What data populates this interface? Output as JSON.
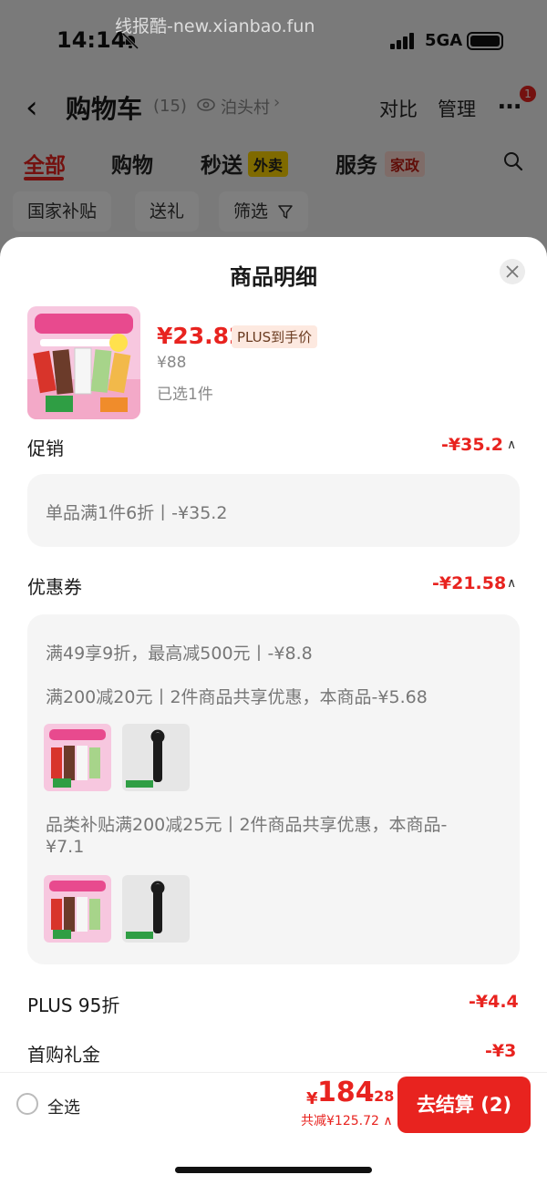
{
  "watermark": "线报酷-new.xianbao.fun",
  "status_bar": {
    "time": "14:14",
    "network": "5GA",
    "icons": [
      "bell-off-icon",
      "signal-icon",
      "battery-icon"
    ]
  },
  "navbar": {
    "title": "购物车",
    "count": "(15)",
    "location": "泊头村",
    "actions": [
      "对比",
      "管理"
    ],
    "more_badge": "1"
  },
  "category_tabs": [
    {
      "label": "全部",
      "active": true
    },
    {
      "label": "购物"
    },
    {
      "label": "秒送",
      "tag": "外卖"
    },
    {
      "label": "服务",
      "tag": "家政"
    }
  ],
  "filters": [
    "国家补贴",
    "送礼",
    "筛选"
  ],
  "sheet": {
    "title": "商品明细",
    "product": {
      "price": "¥23.82",
      "price_tag": "PLUS到手价",
      "original_price": "¥88",
      "selected": "已选1件"
    },
    "promotion": {
      "label": "促销",
      "amount": "-¥35.2",
      "details": [
        "单品满1件6折丨-¥35.2"
      ]
    },
    "coupon": {
      "label": "优惠券",
      "amount": "-¥21.58",
      "details": [
        "满49享9折，最高减500元丨-¥8.8",
        "满200减20元丨2件商品共享优惠，本商品-¥5.68",
        "品类补贴满200减25元丨2件商品共享优惠，本商品-",
        "¥7.1"
      ]
    },
    "plus_discount": {
      "label": "PLUS 95折",
      "amount": "-¥4.4"
    },
    "first_gift": {
      "label": "首购礼金",
      "amount": "-¥3"
    }
  },
  "bottom_bar": {
    "select_all": "全选",
    "currency": "¥",
    "total_int": "184",
    "total_dec": ".28",
    "discount": "共减¥125.72",
    "checkout": "去结算 (2)"
  },
  "colors": {
    "accent": "#e8231f",
    "sheet_bg": "#ffffff",
    "box_bg": "#f5f5f5"
  }
}
